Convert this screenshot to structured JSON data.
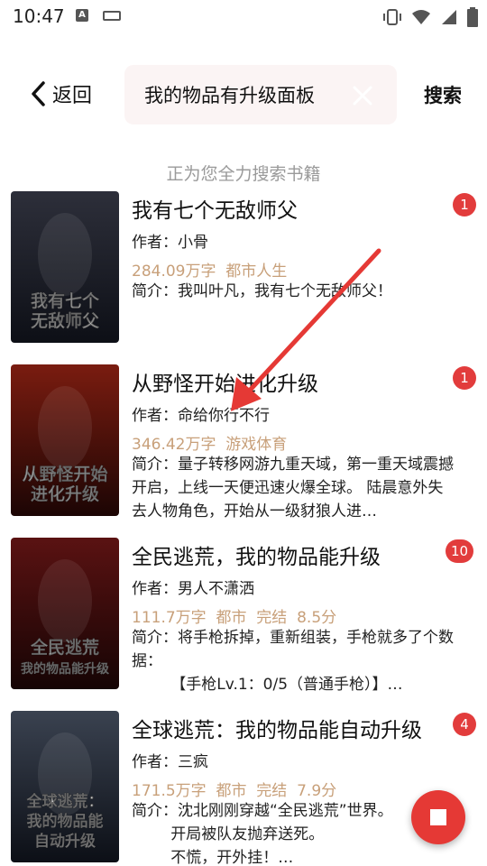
{
  "status_bar": {
    "time": "10:47",
    "icons": [
      "a-icon",
      "keyboard-icon",
      "vibrate-icon",
      "wifi-icon",
      "signal-icon",
      "battery-icon"
    ]
  },
  "top_bar": {
    "back_label": "返回",
    "search_value": "我的物品有升级面板",
    "search_label": "搜索"
  },
  "hint": "正为您全力搜索书籍",
  "books": [
    {
      "title": "我有七个无敌师父",
      "author": "作者：小骨",
      "words": "284.09万字",
      "category": "都市人生",
      "status": "",
      "score": "",
      "intro": "简介：我叫叶凡，我有七个无敌师父！",
      "badge": "1",
      "cover_text": [
        "我有七个",
        "无敌师父"
      ],
      "cover_colors": [
        "#2d2f3a",
        "#0d0f16"
      ]
    },
    {
      "title": "从野怪开始进化升级",
      "author": "作者：命给你行不行",
      "words": "346.42万字",
      "category": "游戏体育",
      "status": "",
      "score": "",
      "intro": "简介：量子转移网游九重天域，第一重天域震撼开启，上线一天便迅速火爆全球。 陆晨意外失去人物角色，开始从一级豺狼人进…",
      "badge": "1",
      "cover_text": [
        "从野怪开始",
        "进化升级"
      ],
      "cover_colors": [
        "#7a1c10",
        "#1c0504"
      ]
    },
    {
      "title": "全民逃荒，我的物品能升级",
      "author": "作者：男人不潇洒",
      "words": "111.7万字",
      "category": "都市",
      "status": "完结",
      "score": "8.5分",
      "intro": "简介：将手枪拆掉，重新组装，手枪就多了个数据：\n        【手枪Lv.1：0/5（普通手枪）】…",
      "badge": "10",
      "cover_text": [
        "全民逃荒",
        "我的物品能升级"
      ],
      "cover_colors": [
        "#5a1212",
        "#150404"
      ]
    },
    {
      "title": "全球逃荒：我的物品能自动升级",
      "author": "作者：三疯",
      "words": "171.5万字",
      "category": "都市",
      "status": "完结",
      "score": "7.9分",
      "intro": "简介：沈北刚刚穿越“全民逃荒”世界。\n        开局被队友抛弃送死。\n        不慌，开外挂！…",
      "badge": "4",
      "cover_text": [
        "全球逃荒：",
        "我的物品能",
        "自动升级"
      ],
      "cover_colors": [
        "#3a4250",
        "#0c0f16"
      ]
    }
  ],
  "colors": {
    "accent": "#e53935",
    "meta": "#c8a07a",
    "badge": "#e23c3c",
    "hint": "#9a9a9a"
  }
}
